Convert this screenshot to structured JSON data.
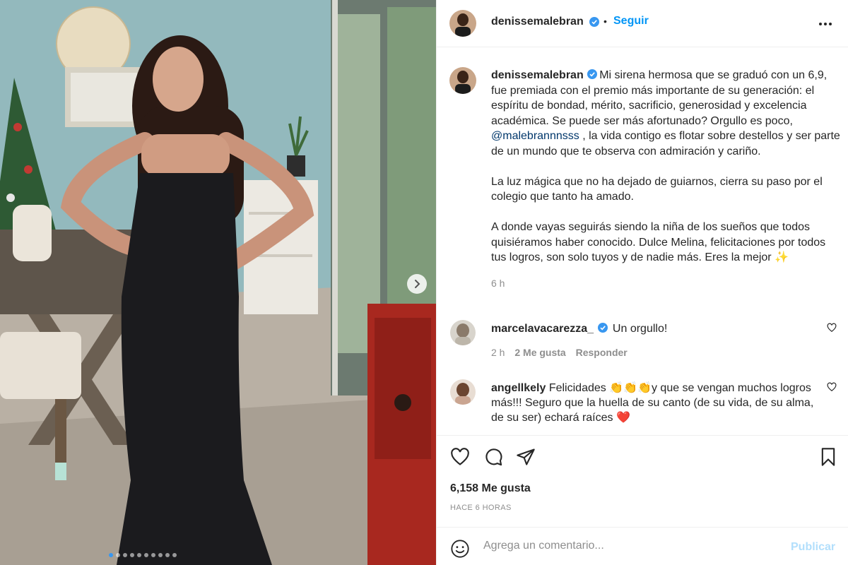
{
  "post": {
    "username": "denissemalebran",
    "follow_label": "Seguir",
    "separator": "•",
    "caption_part1": "Mi sirena hermosa que se graduó con un 6,9, fue premiada con el premio más importante de su generación: el espíritu de bondad, mérito, sacrificio, generosidad y excelencia académica. Se puede ser más afortunado? Orgullo es poco, ",
    "caption_mention": "@malebrannnsss",
    "caption_part2": " , la vida contigo es flotar sobre destellos y ser parte de un mundo que te observa con admiración y cariño.",
    "caption_para2": "La luz mágica que no ha dejado de guiarnos, cierra su paso por el colegio que tanto ha amado.",
    "caption_para3": "A donde vayas seguirás siendo la niña de los sueños que todos quisiéramos haber conocido. Dulce Melina, felicitaciones por todos tus logros, son solo tuyos y de nadie más. Eres la mejor ✨",
    "caption_time": "6 h",
    "likes": "6,158 Me gusta",
    "posted_ago": "HACE 6 HORAS"
  },
  "comments": [
    {
      "username": "marcelavacarezza_",
      "text": "Un orgullo!",
      "time": "2 h",
      "likes": "2 Me gusta",
      "reply": "Responder"
    },
    {
      "username": "angellkely",
      "text_part1": "Felicidades ",
      "emojis": "👏👏👏",
      "text_part2": "y que se vengan muchos logros más!!! Seguro que la huella de su canto (de su vida, de su alma, de su ser) echará raíces ❤️"
    }
  ],
  "add_comment": {
    "placeholder": "Agrega un comentario...",
    "publish_label": "Publicar"
  },
  "colors": {
    "link": "#0095f6",
    "publish_disabled": "#b2dffc",
    "verified": "#3897f0",
    "active_dot": "#3897f0"
  },
  "icons": [
    "verified-badge-icon",
    "more-options-icon",
    "heart-icon",
    "comment-icon",
    "share-icon",
    "bookmark-icon",
    "emoji-icon",
    "next-arrow-icon"
  ],
  "carousel": {
    "total_slides": 10,
    "active_slide": 1
  }
}
